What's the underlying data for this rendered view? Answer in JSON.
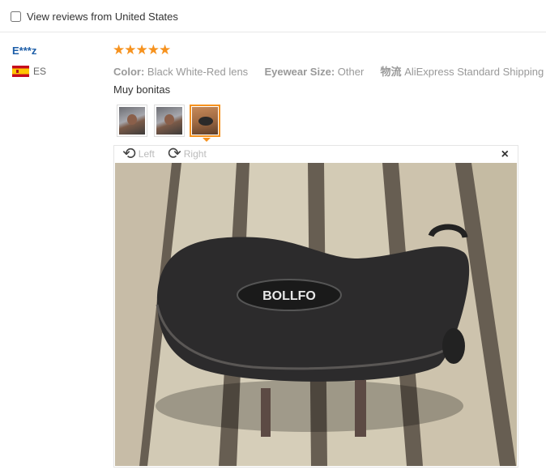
{
  "filter": {
    "label": "View reviews from United States",
    "checked": false
  },
  "review": {
    "user": "E***z",
    "country_code": "ES",
    "stars": "★★★★★",
    "rating": 5,
    "color_label": "Color:",
    "color_value": "Black White-Red lens",
    "size_label": "Eyewear Size:",
    "size_value": "Other",
    "shipping_label": "物流",
    "shipping_value": "AliExpress Standard Shipping",
    "comment": "Muy bonitas",
    "thumbnails_selected": 3
  },
  "viewer": {
    "rotate_left_label": "Left",
    "rotate_right_label": "Right",
    "close_glyph": "×",
    "logo_text": "BOLLFO"
  },
  "colors": {
    "accent": "#f6921e",
    "user_link": "#1d5ea8"
  }
}
